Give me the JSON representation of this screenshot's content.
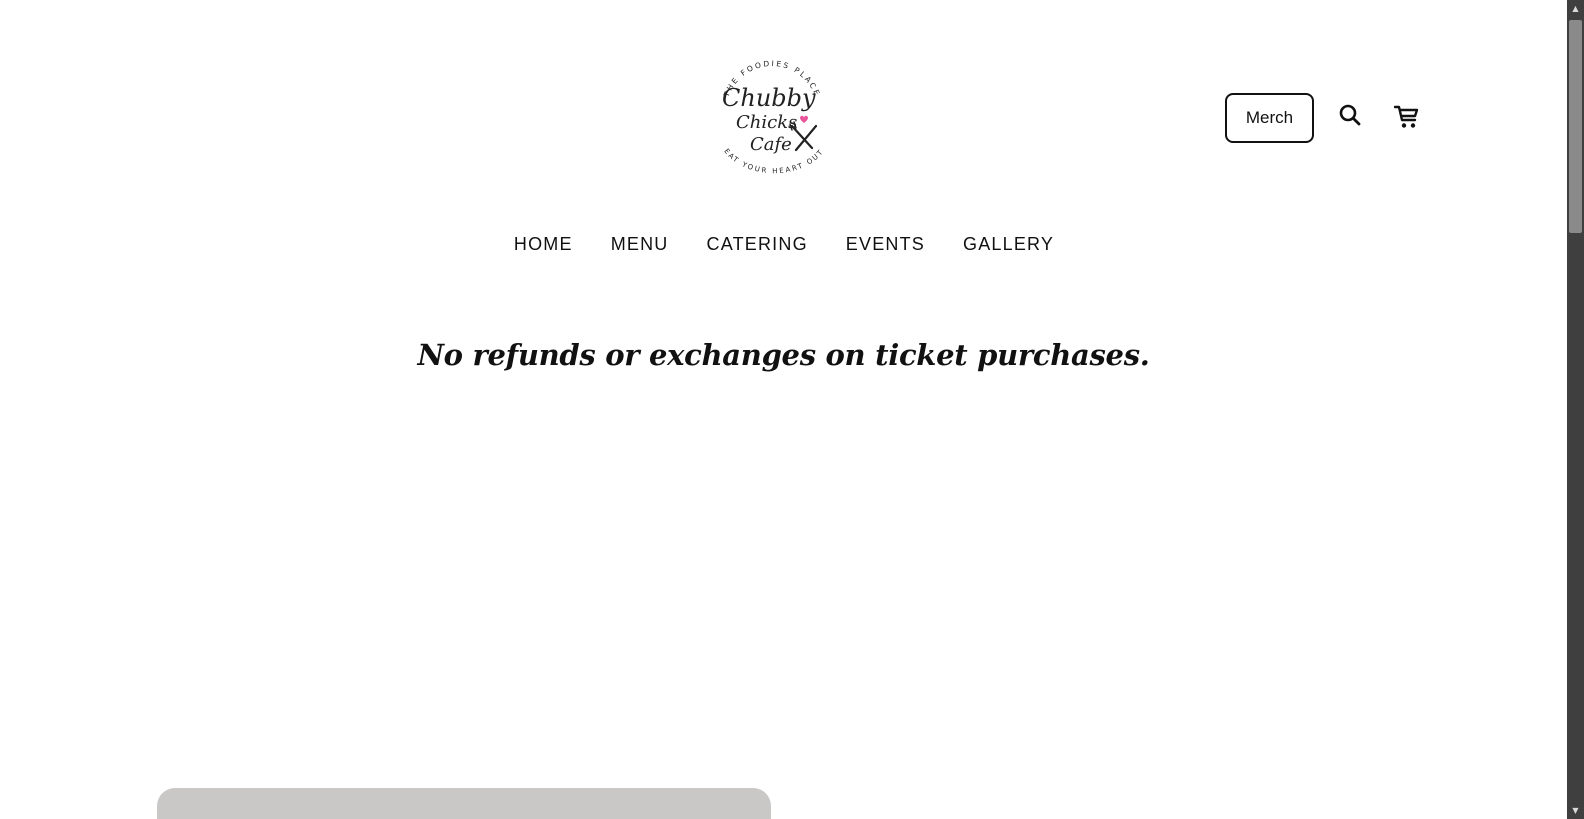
{
  "header": {
    "logo": {
      "top_text": "THE FOODIES PLACE",
      "line1": "Chubby",
      "line2": "Chicks",
      "line3": "Cafe",
      "bottom_text": "EAT YOUR HEART OUT",
      "heart_color": "#e8559b"
    },
    "merch_label": "Merch",
    "search_icon": "search-icon",
    "cart_icon": "cart-icon"
  },
  "nav": {
    "items": [
      {
        "label": "HOME"
      },
      {
        "label": "MENU"
      },
      {
        "label": "CATERING"
      },
      {
        "label": "EVENTS"
      },
      {
        "label": "GALLERY"
      }
    ]
  },
  "main": {
    "notice": "No refunds or exchanges on ticket purchases."
  },
  "colors": {
    "text": "#111111",
    "card": "#c9c8c6",
    "scrollbar_track": "#3f3f3f",
    "scrollbar_thumb": "#8a8a8a"
  }
}
